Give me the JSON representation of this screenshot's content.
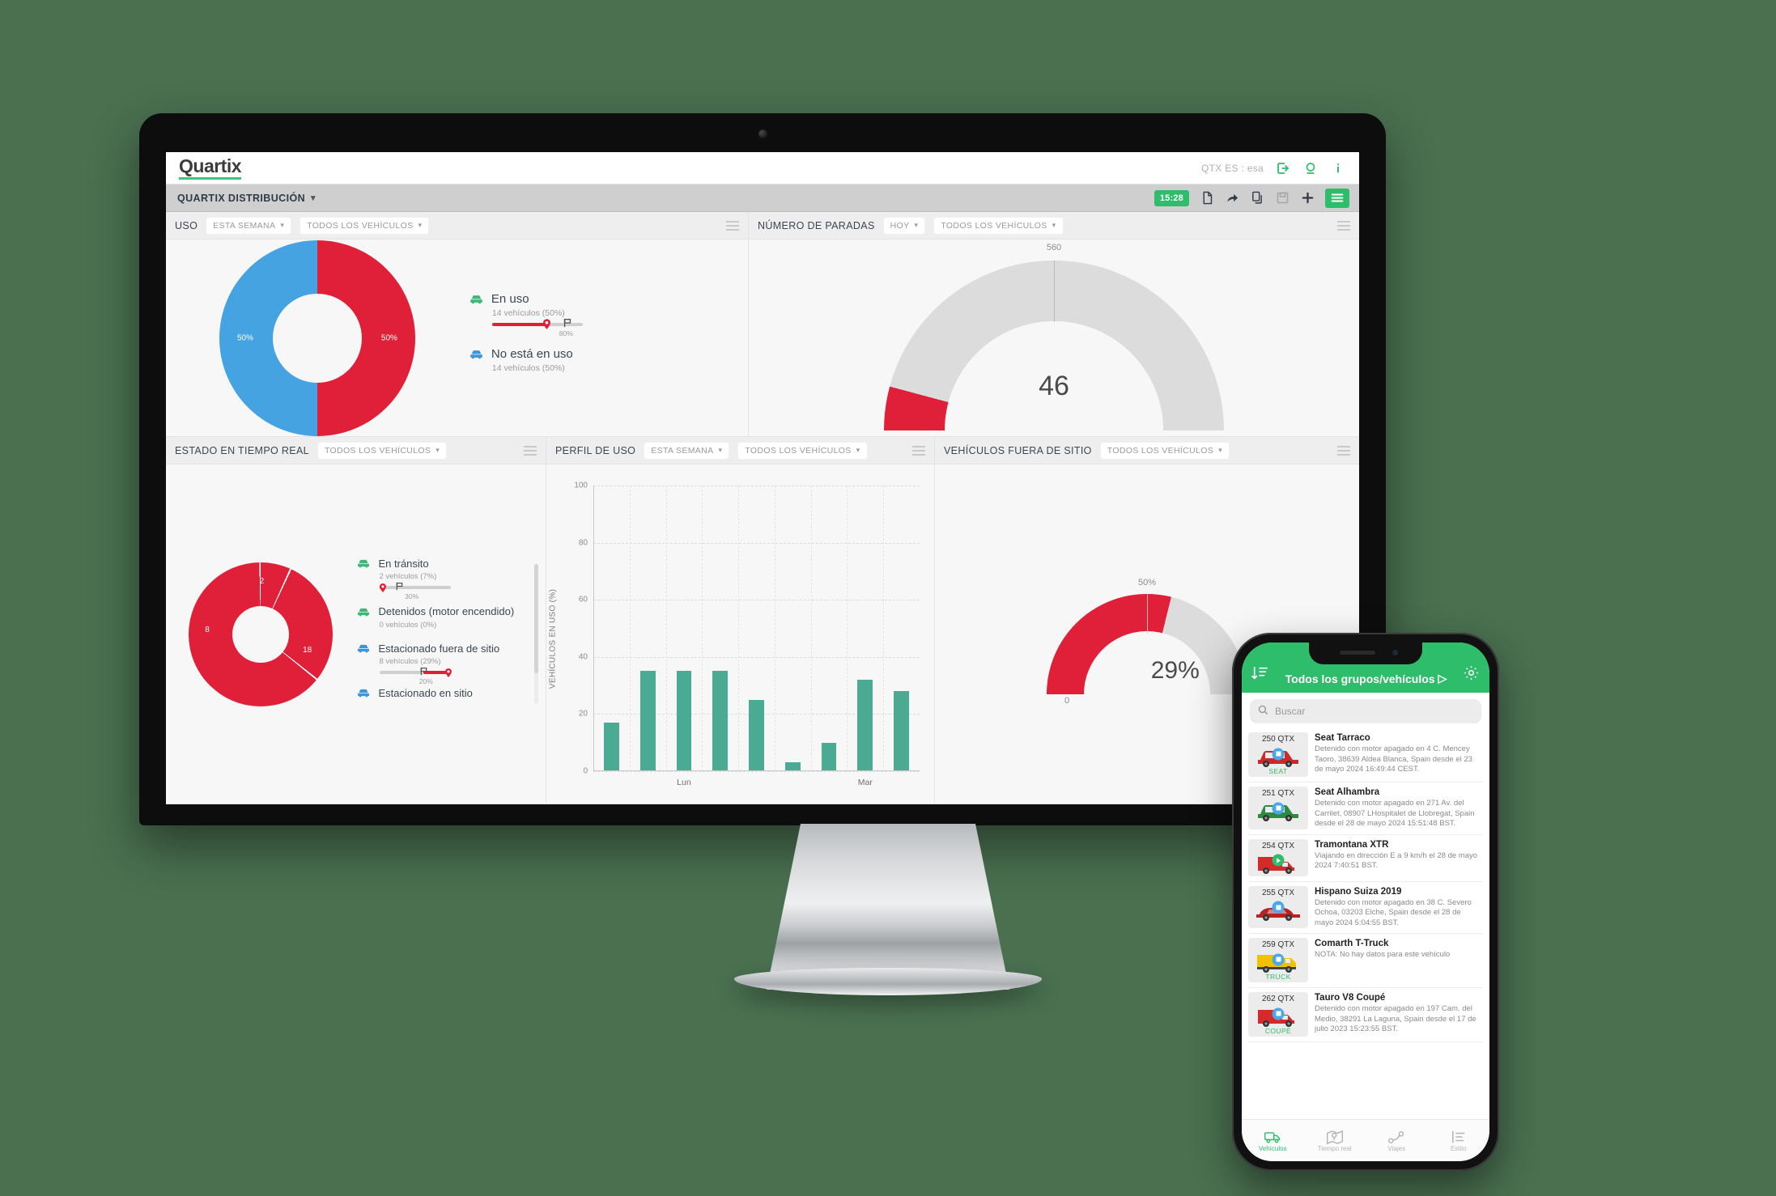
{
  "app": {
    "brand": "Quartix",
    "account": "QTX ES : esa",
    "breadcrumb": "QUARTIX DISTRIBUCIÓN",
    "clock": "15:28",
    "icons": {
      "logout": "logout-icon",
      "support": "support-icon",
      "info": "info-icon",
      "new_doc": "new-document-icon",
      "share": "share-arrow-icon",
      "copy": "copy-icon",
      "save": "save-disk-icon",
      "add": "plus-icon",
      "menu": "hamburger-menu-icon"
    },
    "colors": {
      "green": "#2ebd6b",
      "red": "#e02038",
      "blue": "#44a3e0",
      "teal": "#4aab92",
      "grey": "#dcdcdc",
      "background": "#4a7050"
    }
  },
  "panels": {
    "uso": {
      "title": "USO",
      "filter_period": "ESTA SEMANA",
      "filter_vehicles": "TODOS LOS VEHÍCULOS",
      "legend": [
        {
          "label": "En uso",
          "sub": "14 vehículos (50%)",
          "icon_color": "#3cb878",
          "progress": {
            "percent_label": "80%",
            "fill": 62,
            "pin": 58,
            "flag": 80
          }
        },
        {
          "label": "No está en uso",
          "sub": "14 vehículos (50%)",
          "icon_color": "#3d95d8"
        }
      ]
    },
    "paradas": {
      "title": "NÚMERO DE PARADAS",
      "filter_period": "HOY",
      "filter_vehicles": "TODOS LOS VEHÍCULOS"
    },
    "estado": {
      "title": "ESTADO EN TIEMPO REAL",
      "filter_vehicles": "TODOS LOS VEHÍCULOS",
      "legend": [
        {
          "label": "En tránsito",
          "sub": "2 vehículos (7%)",
          "icon_color": "#3cb878",
          "progress": {
            "percent_label": "30%",
            "fill": 4,
            "pin": 2,
            "flag": 22
          }
        },
        {
          "label": "Detenidos (motor encendido)",
          "sub": "0 vehículos (0%)",
          "icon_color": "#3cb878"
        },
        {
          "label": "Estacionado fuera de sitio",
          "sub": "8 vehículos (29%)",
          "icon_color": "#3d95d8",
          "progress": {
            "percent_label": "20%",
            "fill_start": 62,
            "fill_end": 100,
            "flag": 58,
            "pin": 98
          }
        },
        {
          "label": "Estacionado en sitio",
          "sub": "",
          "icon_color": "#3d95d8"
        }
      ]
    },
    "perfil": {
      "title": "PERFIL DE USO",
      "filter_period": "ESTA SEMANA",
      "filter_vehicles": "TODOS LOS VEHÍCULOS"
    },
    "fuera": {
      "title": "VEHÍCULOS FUERA DE SITIO",
      "filter_vehicles": "TODOS LOS VEHÍCULOS"
    }
  },
  "chart_data": [
    {
      "type": "pie",
      "name": "uso-donut",
      "title": "USO",
      "labels": [
        "En uso",
        "No está en uso"
      ],
      "values": [
        50,
        50
      ],
      "value_labels": [
        "50%",
        "50%"
      ],
      "colors": [
        "#e02038",
        "#44a3e0"
      ],
      "counts": [
        14,
        14
      ],
      "legend": "right",
      "donut": true
    },
    {
      "type": "gauge",
      "name": "numero-de-paradas",
      "title": "NÚMERO DE PARADAS",
      "value": 46,
      "value_label": "46",
      "min": 0,
      "max": 560,
      "max_label": "560",
      "tick_labels": [
        "560"
      ],
      "color": "#e02038",
      "track_color": "#dcdcdc"
    },
    {
      "type": "pie",
      "name": "estado-en-tiempo-real",
      "title": "ESTADO EN TIEMPO REAL",
      "labels": [
        "En tránsito",
        "Detenidos (motor encendido)",
        "Estacionado fuera de sitio",
        "Estacionado en sitio"
      ],
      "values": [
        2,
        0,
        8,
        18
      ],
      "value_labels": [
        "2",
        "8",
        "18"
      ],
      "colors": [
        "#e02038",
        "#e02038",
        "#e02038"
      ],
      "donut": true
    },
    {
      "type": "bar",
      "name": "perfil-de-uso",
      "title": "PERFIL DE USO",
      "categories": [
        "",
        "",
        "Lun",
        "",
        "",
        "",
        "",
        "Mar",
        ""
      ],
      "values": [
        17,
        35,
        35,
        35,
        25,
        3,
        10,
        32,
        28
      ],
      "xlabel": "",
      "ylabel": "VEHÍCULOS EN USO (%)",
      "ylim": [
        0,
        100
      ],
      "yticks": [
        0,
        20,
        40,
        60,
        80,
        100
      ],
      "xtick_labels": [
        "Lun",
        "Mar"
      ],
      "color": "#4aab92",
      "grid": true
    },
    {
      "type": "gauge",
      "name": "vehiculos-fuera-de-sitio",
      "title": "VEHÍCULOS FUERA DE SITIO",
      "value": 29,
      "value_label": "29%",
      "min": 0,
      "max": 50,
      "min_label": "0",
      "max_label": "50%",
      "tick_labels": [
        "0",
        "50%"
      ],
      "color": "#e02038",
      "track_color": "#dcdcdc"
    }
  ],
  "phone": {
    "header_title": "Todos los grupos/vehículos",
    "sort_icon": "sort-descending-icon",
    "settings_icon": "gear-icon",
    "search_placeholder": "Buscar",
    "search_value": "",
    "vehicles": [
      {
        "plate": "250 QTX",
        "tag": "SEAT",
        "name": "Seat Tarraco",
        "desc": "Detenido con motor apagado en 4 C. Mencey Taoro, 38639 Aldea Blanca, Spain desde el 23 de mayo 2024 16:49:44 CEST.",
        "color": "#cc2a2a",
        "shape": "suv",
        "badge": "stopped"
      },
      {
        "plate": "251 QTX",
        "tag": "",
        "name": "Seat Alhambra",
        "desc": "Detenido con motor apagado en 271 Av. del Carrilet, 08907 LHospitalet de Llobregat, Spain desde el 28 de mayo 2024 15:51:48 BST.",
        "color": "#2f8a3f",
        "shape": "suv",
        "badge": "stopped"
      },
      {
        "plate": "254 QTX",
        "tag": "",
        "name": "Tramontana XTR",
        "desc": "Viajando en dirección E a 9 km/h el 28 de mayo 2024 7:40:51 BST.",
        "color": "#d42a2a",
        "shape": "pickup",
        "badge": "moving"
      },
      {
        "plate": "255 QTX",
        "tag": "",
        "name": "Hispano Suiza 2019",
        "desc": "Detenido con motor apagado en 38 C. Severo Ochoa, 03203 Elche, Spain desde el 28 de mayo 2024 5:04:55 BST.",
        "color": "#b82222",
        "shape": "sports",
        "badge": "stopped"
      },
      {
        "plate": "259 QTX",
        "tag": "TRUCK",
        "name": "Comarth T-Truck",
        "desc": "NOTA: No hay datos para este vehículo",
        "color": "#f2c200",
        "shape": "truck",
        "badge": "stopped"
      },
      {
        "plate": "262 QTX",
        "tag": "COUPÉ",
        "name": "Tauro V8 Coupé",
        "desc": "Detenido con motor apagado en 197 Cam. del Medio, 38291 La Laguna, Spain desde el 17 de julio 2023 15:23:55 BST.",
        "color": "#d42a2a",
        "shape": "pickup",
        "badge": "stopped"
      }
    ],
    "nav": [
      {
        "label": "Vehículos",
        "icon": "truck-icon",
        "active": true
      },
      {
        "label": "Tiempo real",
        "icon": "map-pin-icon",
        "active": false
      },
      {
        "label": "Viajes",
        "icon": "route-icon",
        "active": false
      },
      {
        "label": "Estilo",
        "icon": "list-icon",
        "active": false
      }
    ]
  }
}
